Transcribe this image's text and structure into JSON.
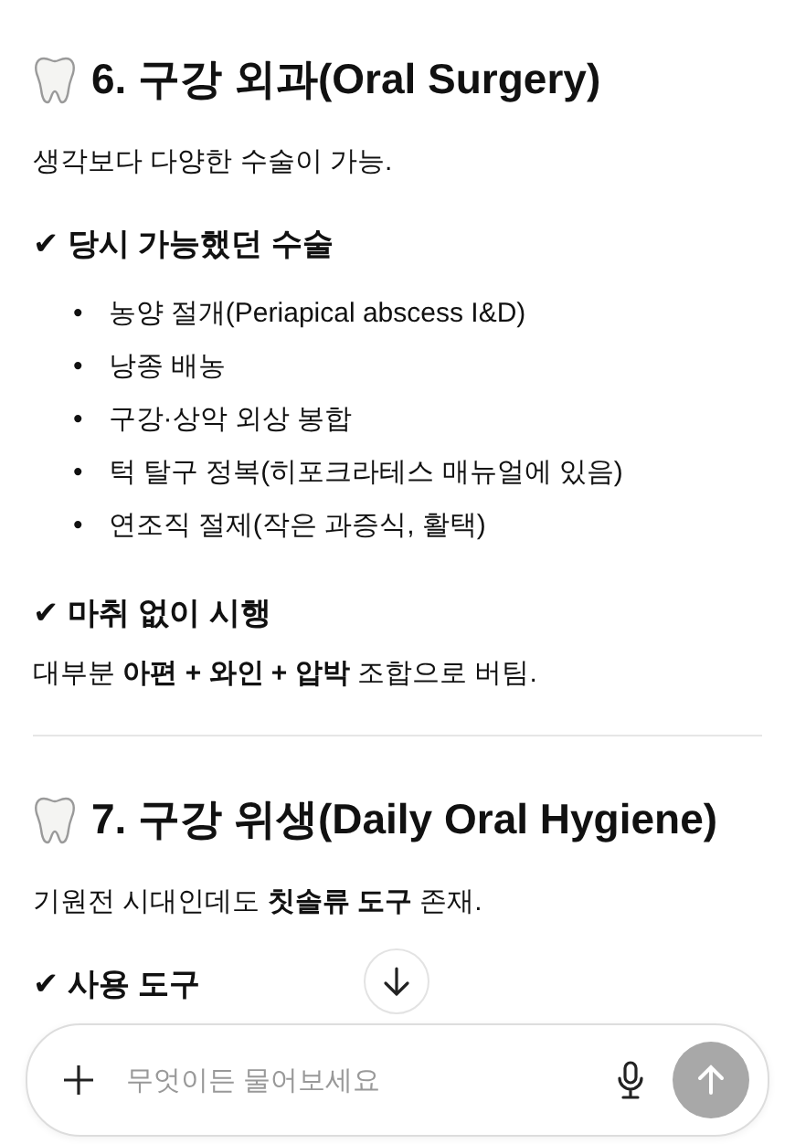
{
  "sections": [
    {
      "heading": "6. 구강 외과(Oral Surgery)",
      "intro": "생각보다 다양한 수술이 가능.",
      "blocks": [
        {
          "subheading": "✔ 당시 가능했던 수술",
          "bullets": [
            {
              "marker": "•",
              "text": "농양 절개(Periapical abscess I&D)"
            },
            {
              "marker": "•",
              "text": "낭종 배농"
            },
            {
              "marker": "•",
              "text": "구강·상악 외상 봉합"
            },
            {
              "marker": "•",
              "text": "턱 탈구 정복(히포크라테스 매뉴얼에 있음)"
            },
            {
              "marker": "•",
              "text": "연조직 절제(작은 과증식, 활택)"
            }
          ]
        },
        {
          "subheading": "✔ 마취 없이 시행",
          "text": "대부분 **아편 + 와인 + 압박** 조합으로 버팀."
        }
      ]
    },
    {
      "heading": "7. 구강 위생(Daily Oral Hygiene)",
      "intro": "기원전 시대인데도 **칫솔류 도구** 존재.",
      "blocks": [
        {
          "subheading": "✔ 사용 도구"
        }
      ]
    }
  ],
  "composer": {
    "placeholder": "무엇이든 물어보세요"
  }
}
